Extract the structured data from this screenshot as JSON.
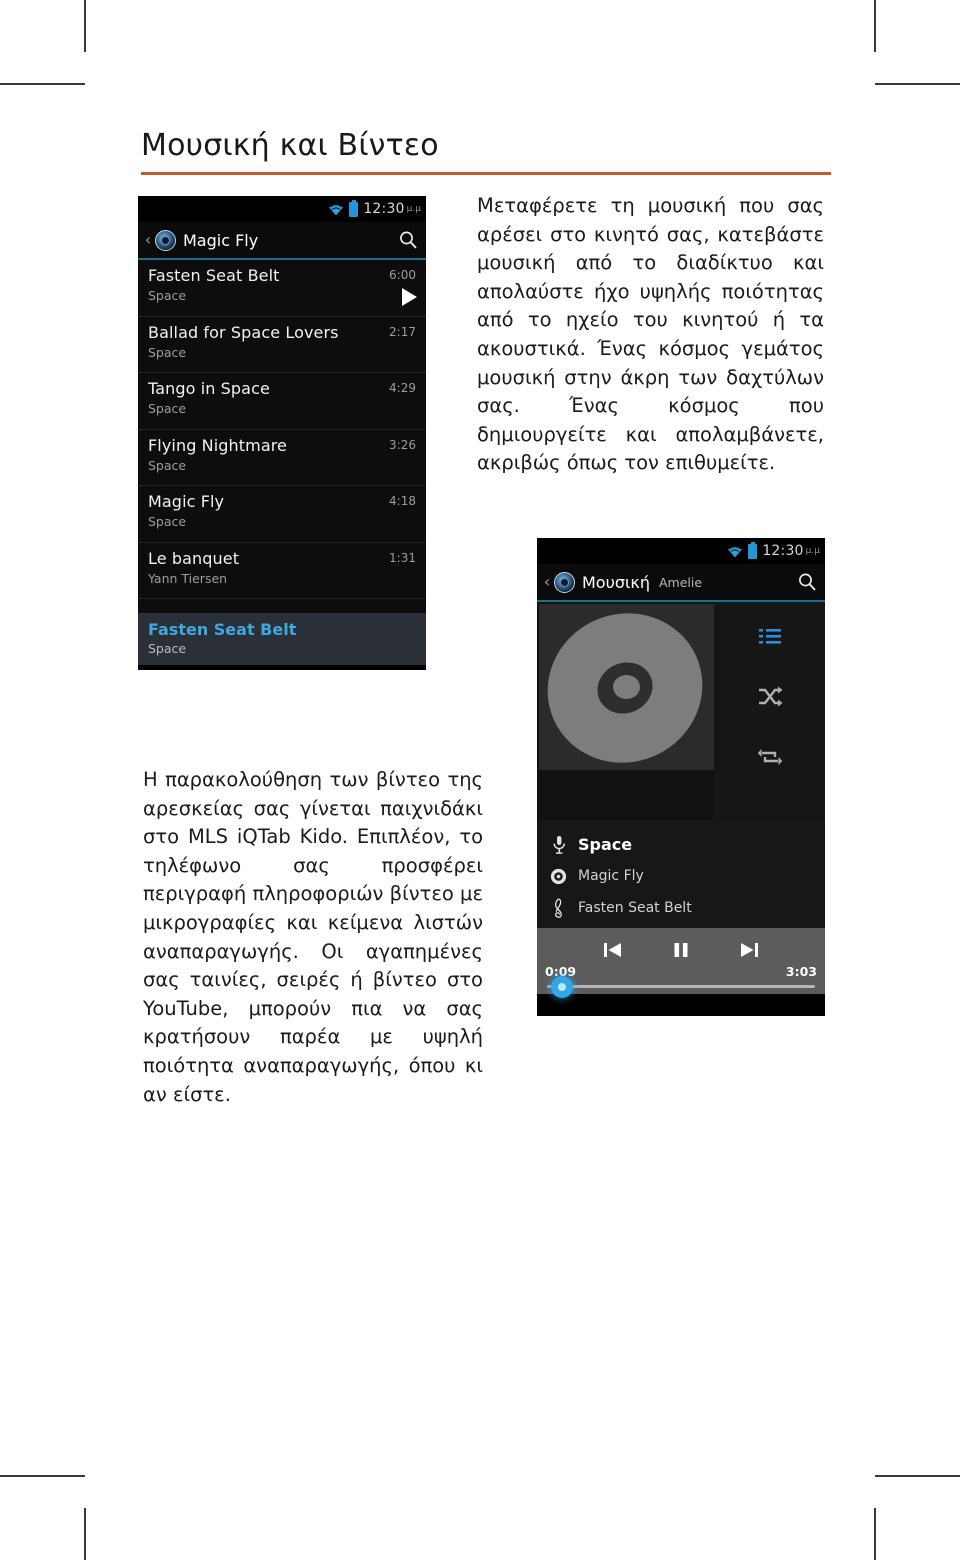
{
  "page": {
    "title": "Μουσική και Βίντεο",
    "accent_color": "#c35a2e"
  },
  "paragraphs": {
    "intro": "Μεταφέρετε τη μουσική που σας αρέσει στο κινητό σας, κατεβάστε μουσική από το διαδίκτυο και απολαύστε ήχο υψηλής ποιότητας από το ηχείο του κινητού ή τα ακουστικά. Ένας κόσμος γεμάτος μουσική στην άκρη των δαχτύλων σας. Ένας κόσμος που δημιουργείτε και απολαμβάνετε, ακριβώς όπως τον επιθυμείτε.",
    "video": "Η παρακολούθηση των βίντεο της αρεσκείας σας γίνεται παιχνιδάκι στο MLS iQTab Kido. Επιπλέον, το τηλέφωνο σας προσφέρει περιγραφή πληροφοριών βίντεο με μικρογραφίες και κείμενα λιστών αναπαραγωγής. Οι αγαπημένες σας ταινίες, σειρές ή βίντεο στο YouTube, μπορούν πια να σας κρατήσουν παρέα με υψηλή ποιότητα αναπαραγωγής, όπου κι αν είστε."
  },
  "tracklist_screen": {
    "statusbar": {
      "clock": "12:30",
      "ampm": "μ.μ",
      "wifi_icon": "wifi-icon",
      "battery_icon": "battery-icon"
    },
    "actionbar": {
      "back_glyph": "‹",
      "app_icon": "music-app-icon",
      "title": "Magic Fly",
      "search_icon": "search-icon"
    },
    "tracks": [
      {
        "title": "Fasten Seat Belt",
        "artist": "Space",
        "duration": "6:00",
        "playing": true
      },
      {
        "title": "Ballad for Space Lovers",
        "artist": "Space",
        "duration": "2:17",
        "playing": false
      },
      {
        "title": "Tango in Space",
        "artist": "Space",
        "duration": "4:29",
        "playing": false
      },
      {
        "title": "Flying Nightmare",
        "artist": "Space",
        "duration": "3:26",
        "playing": false
      },
      {
        "title": "Magic Fly",
        "artist": "Space",
        "duration": "4:18",
        "playing": false
      },
      {
        "title": "Le banquet",
        "artist": "Yann Tiersen",
        "duration": "1:31",
        "playing": false
      }
    ],
    "now_playing": {
      "title": "Fasten Seat Belt",
      "artist": "Space"
    }
  },
  "player_screen": {
    "statusbar": {
      "clock": "12:30",
      "ampm": "μ.μ",
      "wifi_icon": "wifi-icon",
      "battery_icon": "battery-icon"
    },
    "actionbar": {
      "back_glyph": "‹",
      "app_icon": "music-app-icon",
      "title": "Μουσική",
      "subtitle": "Amelie",
      "search_icon": "search-icon"
    },
    "side_controls": [
      {
        "name": "playlist-icon",
        "active": true
      },
      {
        "name": "shuffle-icon",
        "active": false
      },
      {
        "name": "repeat-icon",
        "active": false
      }
    ],
    "meta": {
      "artist_icon": "microphone-icon",
      "artist": "Space",
      "album_icon": "disc-icon",
      "album": "Magic Fly",
      "song_icon": "treble-clef-icon",
      "song": "Fasten Seat Belt"
    },
    "transport": {
      "previous_icon": "previous-track-icon",
      "pause_icon": "pause-icon",
      "next_icon": "next-track-icon",
      "elapsed": "0:09",
      "total": "3:03"
    }
  }
}
